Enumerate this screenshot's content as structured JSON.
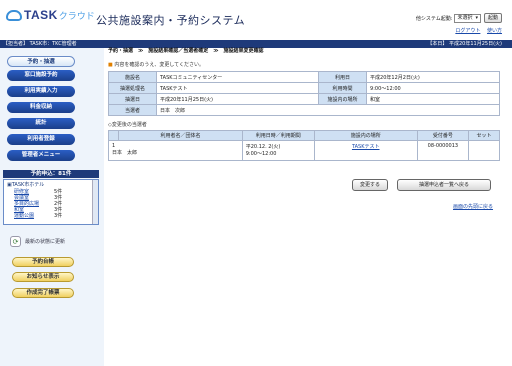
{
  "header": {
    "logo_main": "TASK",
    "logo_sub": "クラウド",
    "title": "公共施設案内・予約システム",
    "other_system_label": "他システム起動:",
    "other_system_value": "未選択",
    "launch_label": "起動",
    "logout": "ログアウト",
    "help": "使い方"
  },
  "bar": {
    "user": "【担当者】 TASK市：TKC管理者",
    "today": "【本日】 平成20年11月25日(火)"
  },
  "breadcrumb": "予約・抽選　≫　施設結果確認／当選者確定　≫　施設結果変更確認",
  "sidebar": {
    "menu": [
      "予約・抽選",
      "窓口施設予約",
      "利用実績入力",
      "料金収納",
      "統計",
      "利用者登録",
      "管理者メニュー"
    ],
    "requests_title": "予約申込：81件",
    "facility": "TASK市ホテル",
    "rows": [
      {
        "name": "研修室",
        "count": "5件"
      },
      {
        "name": "会議室",
        "count": "3件"
      },
      {
        "name": "多目的広場",
        "count": "2件"
      },
      {
        "name": "和室",
        "count": "3件"
      },
      {
        "name": "運動公園",
        "count": "3件"
      }
    ],
    "refresh": "最新の状態に更新",
    "buttons": [
      "予約台帳",
      "お知らせ表示",
      "作成完了帳票"
    ]
  },
  "main": {
    "confirm_note": "内容を確認のうえ、変更してください。",
    "info": [
      {
        "label": "施設名",
        "value": "TASKコミュニティセンター",
        "label2": "利用日",
        "value2": "平成20年12月2日(火)"
      },
      {
        "label": "抽選処理名",
        "value": "TASKテスト",
        "label2": "利用時間",
        "value2": "9:00〜12:00"
      },
      {
        "label": "抽選日",
        "value": "平成20年11月25日(火)",
        "label2": "施設内の場所",
        "value2": "和室"
      },
      {
        "label": "当選者",
        "value": "日本　次郎",
        "label2": "",
        "value2": ""
      }
    ],
    "after_title": "◇変更後の当選者",
    "cols": [
      "",
      "利用者名／団体名",
      "利用日時／利用期間",
      "施設内の場所",
      "受付番号",
      "セット"
    ],
    "row": {
      "no": "1",
      "name": "日本　太郎",
      "date": "平20.12. 2(火)",
      "time": "9:00〜12:00",
      "place": "TASKテスト",
      "receipt": "08-0000013",
      "set": ""
    },
    "change_btn": "変更する",
    "back_btn": "抽選申込者一覧へ戻る",
    "top_link": "画面の先頭に戻る"
  }
}
